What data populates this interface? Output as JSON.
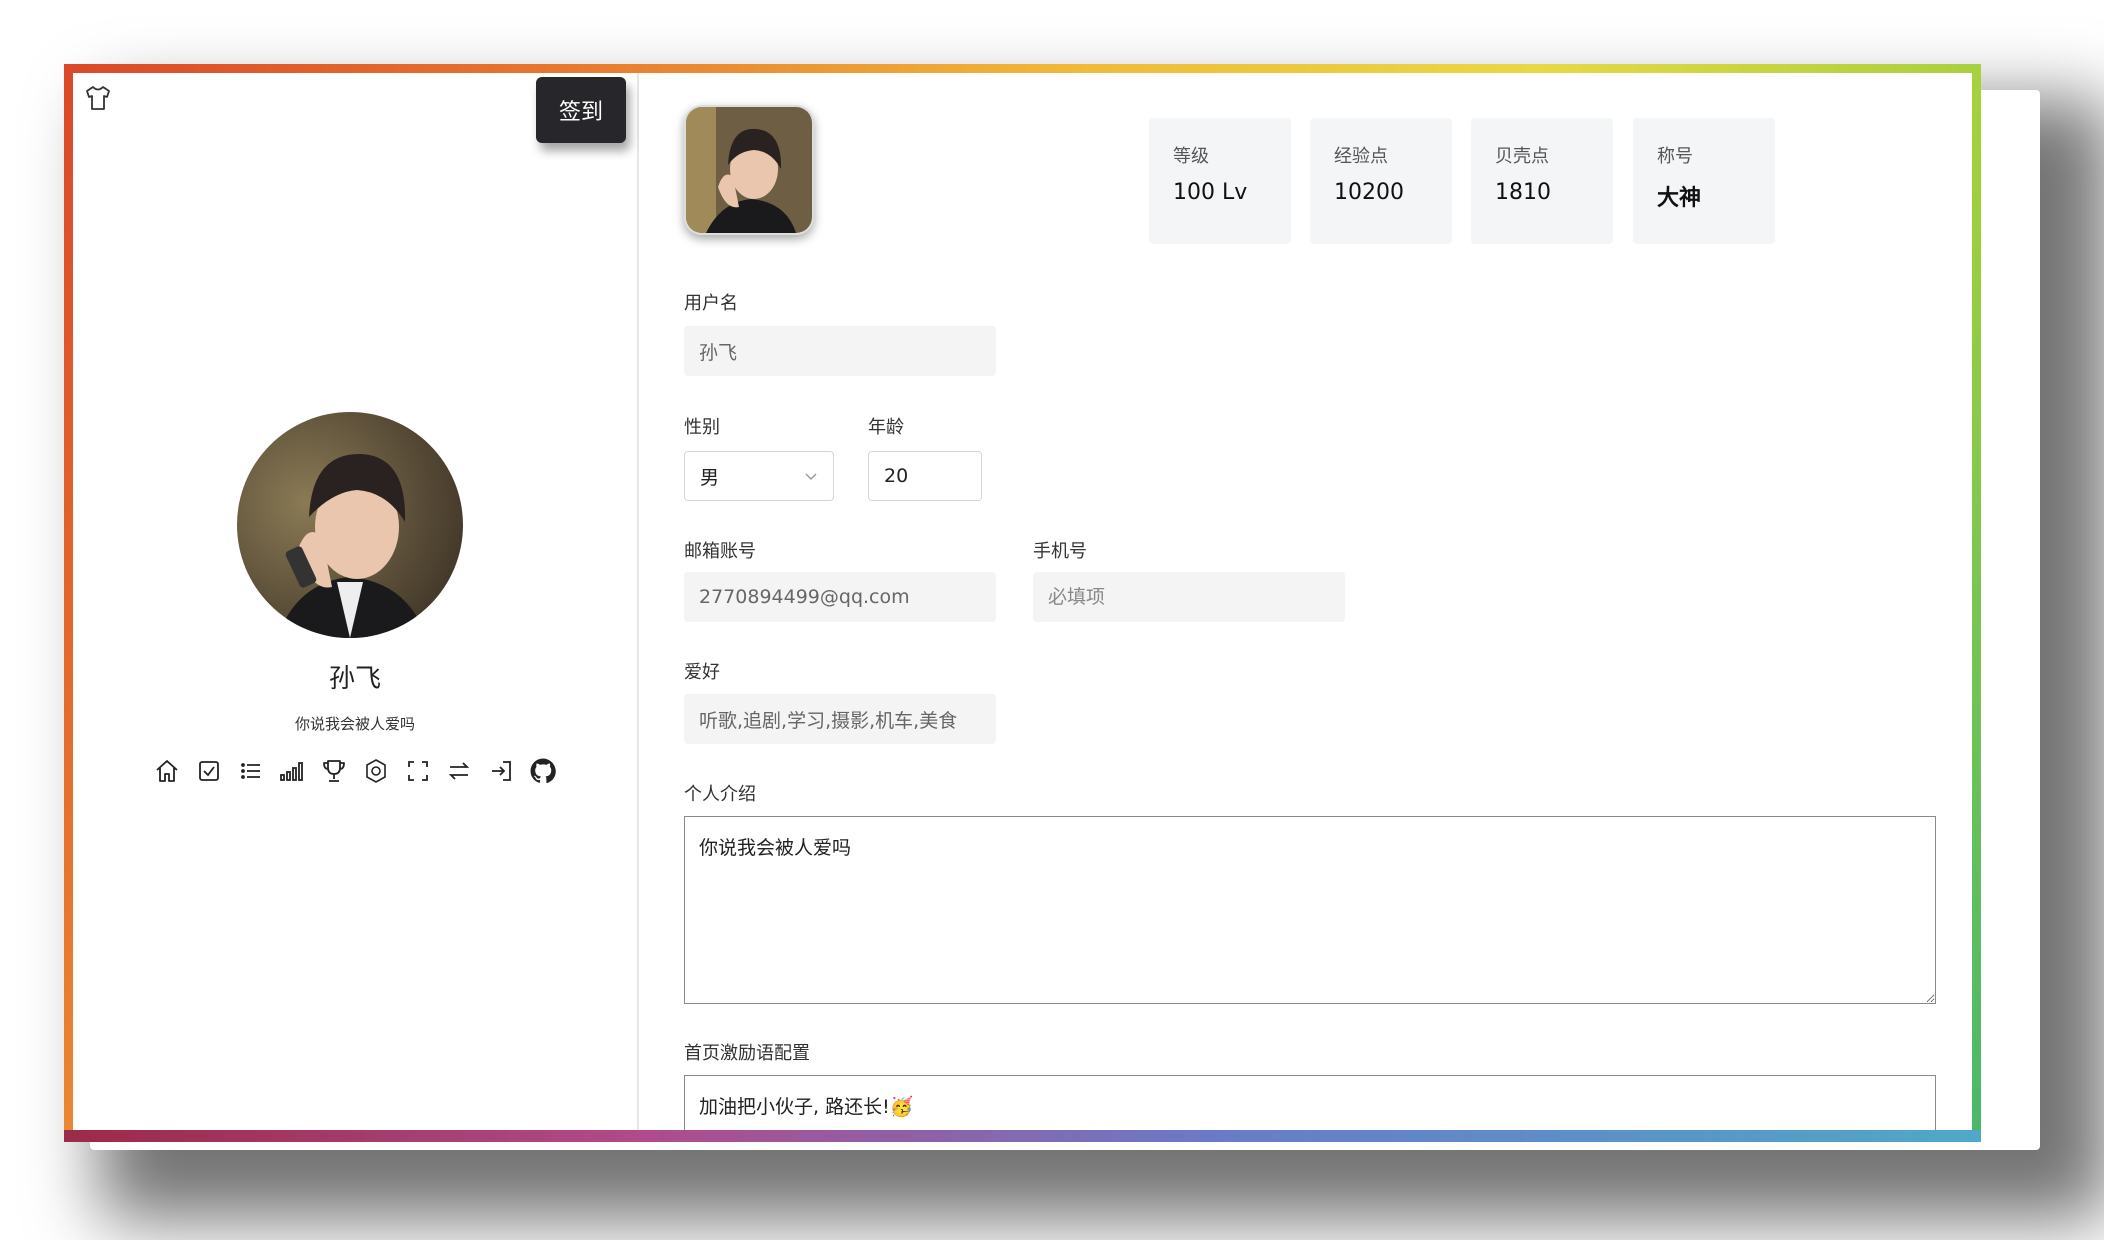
{
  "checkin": {
    "label": "签到"
  },
  "profile": {
    "name": "孙飞",
    "motto": "你说我会被人爱吗"
  },
  "nav_icons": [
    "home-icon",
    "checkbox-icon",
    "list-icon",
    "signal-bars-icon",
    "trophy-icon",
    "settings-cube-icon",
    "fullscreen-icon",
    "switch-arrows-icon",
    "login-icon",
    "github-icon"
  ],
  "stats": [
    {
      "label": "等级",
      "value": "100 Lv"
    },
    {
      "label": "经验点",
      "value": "10200"
    },
    {
      "label": "贝壳点",
      "value": "1810"
    },
    {
      "label": "称号",
      "value": "大神"
    }
  ],
  "form": {
    "username": {
      "label": "用户名",
      "value": "孙飞"
    },
    "gender": {
      "label": "性别",
      "value": "男"
    },
    "age": {
      "label": "年龄",
      "value": "20"
    },
    "email": {
      "label": "邮箱账号",
      "value": "2770894499@qq.com"
    },
    "phone": {
      "label": "手机号",
      "placeholder": "必填项"
    },
    "hobby": {
      "label": "爱好",
      "value": "听歌,追剧,学习,摄影,机车,美食"
    },
    "intro": {
      "label": "个人介绍",
      "value": "你说我会被人爱吗"
    },
    "slogan": {
      "label": "首页激励语配置",
      "value": "加油把小伙子, 路还长!🥳"
    }
  }
}
